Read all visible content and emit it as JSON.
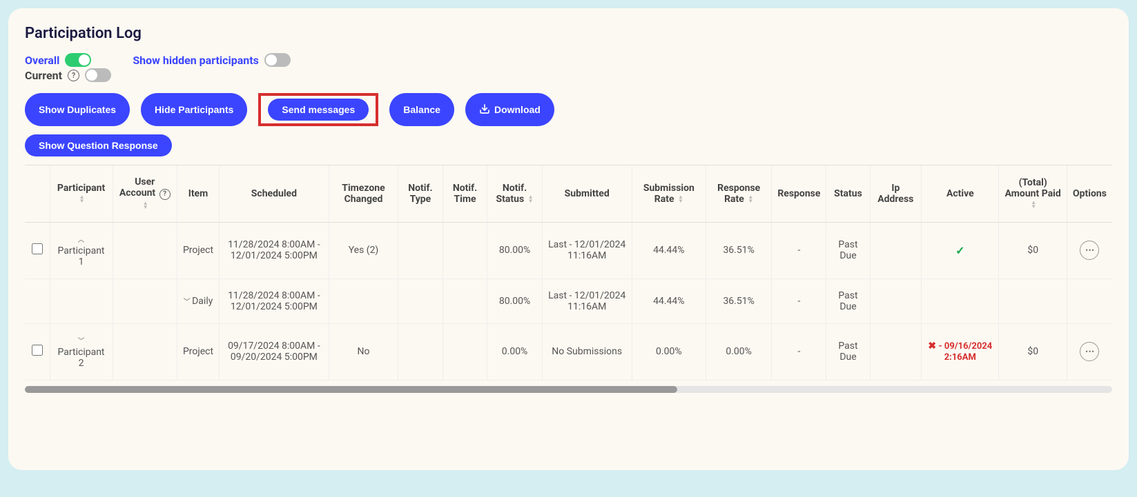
{
  "page_title": "Participation Log",
  "filters": {
    "overall": {
      "label": "Overall",
      "on": true
    },
    "current": {
      "label": "Current",
      "on": false
    },
    "show_hidden": {
      "label": "Show hidden participants",
      "on": false
    }
  },
  "actions": {
    "show_duplicates": "Show Duplicates",
    "hide_participants": "Hide Participants",
    "send_messages": "Send messages",
    "balance": "Balance",
    "download": "Download",
    "show_question_response": "Show Question Response"
  },
  "columns": {
    "checkbox": "",
    "participant": "Participant",
    "user_account": "User Account",
    "item": "Item",
    "scheduled": "Scheduled",
    "timezone_changed": "Timezone Changed",
    "notif_type": "Notif. Type",
    "notif_time": "Notif. Time",
    "notif_status": "Notif. Status",
    "submitted": "Submitted",
    "submission_rate": "Submission Rate",
    "response_rate": "Response Rate",
    "response": "Response",
    "status": "Status",
    "ip_address": "Ip Address",
    "active": "Active",
    "amount_paid": "(Total) Amount Paid",
    "options": "Options"
  },
  "rows": [
    {
      "expand": "up",
      "participant": "Participant 1",
      "user_account": "",
      "item": "Project",
      "scheduled": "11/28/2024 8:00AM - 12/01/2024 5:00PM",
      "timezone_changed": "Yes (2)",
      "notif_type": "",
      "notif_time": "",
      "notif_status": "80.00%",
      "submitted": "Last - 12/01/2024 11:16AM",
      "submission_rate": "44.44%",
      "response_rate": "36.51%",
      "response": "-",
      "status": "Past Due",
      "ip_address": "",
      "active_kind": "check",
      "active_text": "",
      "amount_paid": "$0",
      "show_checkbox": true,
      "show_options": true
    },
    {
      "expand": "down",
      "participant": "",
      "user_account": "",
      "item": "Daily",
      "scheduled": "11/28/2024 8:00AM - 12/01/2024 5:00PM",
      "timezone_changed": "",
      "notif_type": "",
      "notif_time": "",
      "notif_status": "80.00%",
      "submitted": "Last - 12/01/2024 11:16AM",
      "submission_rate": "44.44%",
      "response_rate": "36.51%",
      "response": "-",
      "status": "Past Due",
      "ip_address": "",
      "active_kind": "blank",
      "active_text": "",
      "amount_paid": "",
      "show_checkbox": false,
      "show_options": false,
      "item_caret": true
    },
    {
      "expand": "down",
      "participant": "Participant 2",
      "user_account": "",
      "item": "Project",
      "scheduled": "09/17/2024 8:00AM - 09/20/2024 5:00PM",
      "timezone_changed": "No",
      "notif_type": "",
      "notif_time": "",
      "notif_status": "0.00%",
      "submitted": "No Submissions",
      "submission_rate": "0.00%",
      "response_rate": "0.00%",
      "response": "-",
      "status": "Past Due",
      "ip_address": "",
      "active_kind": "x",
      "active_text": "- 09/16/2024 2:16AM",
      "amount_paid": "$0",
      "show_checkbox": true,
      "show_options": true
    }
  ]
}
